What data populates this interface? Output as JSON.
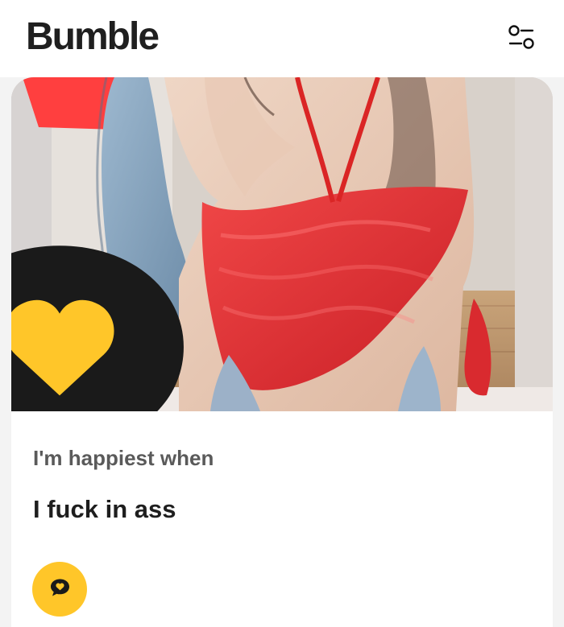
{
  "header": {
    "brand": "Bumble",
    "filter_icon": "filter-sliders-icon"
  },
  "profile": {
    "photo_action_icon": "comment-bubble-icon",
    "prompt": {
      "question": "I'm happiest when",
      "answer": "I fuck in ass",
      "action_icon": "comment-bubble-icon"
    }
  },
  "colors": {
    "accent": "#ffc629",
    "brand_text": "#1f1f1f",
    "prompt_label": "#5a5a5a"
  }
}
